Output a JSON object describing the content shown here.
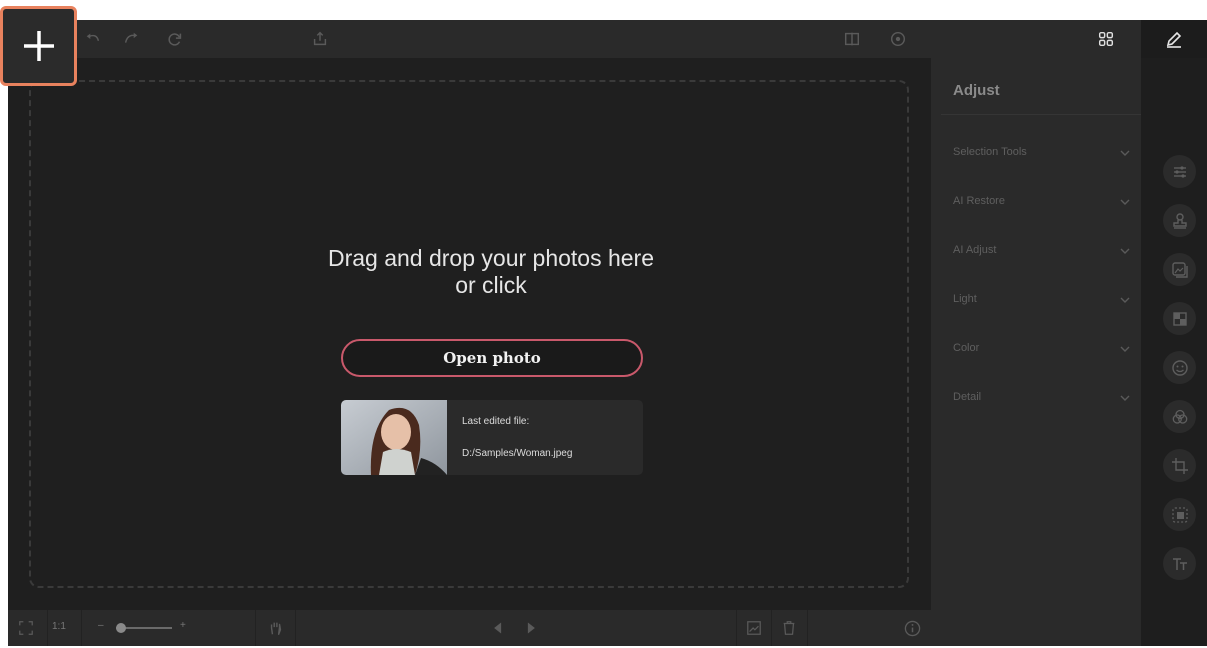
{
  "toolbar": {
    "icons": [
      "add-icon",
      "undo-icon",
      "redo-icon",
      "reset-icon",
      "export-icon",
      "compare-icon",
      "preview-icon",
      "gallery-icon",
      "edit-icon"
    ]
  },
  "canvas": {
    "drop_text_line1": "Drag and drop your photos here",
    "drop_text_line2": "or click",
    "open_photo_label": "Open photo",
    "last_edited_label": "Last edited file:",
    "last_edited_path": "D:/Samples/Woman.jpeg"
  },
  "bottombar": {
    "zoom_label": "1:1",
    "zoom_minus": "–",
    "zoom_plus": "+"
  },
  "right_panel": {
    "title": "Adjust",
    "sections": [
      {
        "label": "Selection Tools"
      },
      {
        "label": "AI Restore"
      },
      {
        "label": "AI Adjust"
      },
      {
        "label": "Light"
      },
      {
        "label": "Color"
      },
      {
        "label": "Detail"
      }
    ]
  },
  "tools": [
    "adjust-sliders-icon",
    "stamp-icon",
    "image-frame-icon",
    "mosaic-icon",
    "face-retouch-icon",
    "color-circles-icon",
    "crop-icon",
    "resize-icon",
    "text-icon"
  ],
  "colors": {
    "accent_border": "#e8825e",
    "open_button_border": "#c9596b",
    "background": "#1f1f1f"
  }
}
